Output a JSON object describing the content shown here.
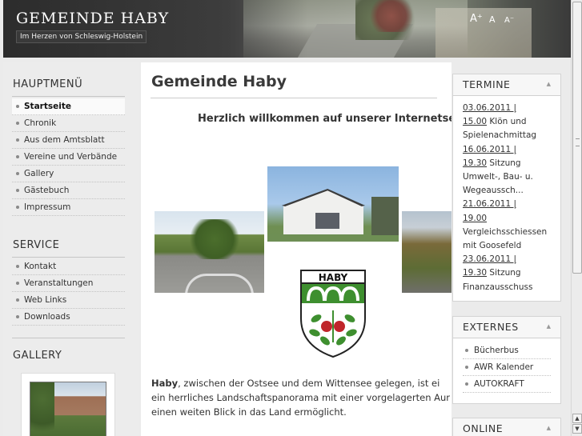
{
  "header": {
    "site_title": "GEMEINDE HABY",
    "slogan": "Im Herzen von Schleswig-Holstein",
    "font_increase": "A⁺",
    "font_reset": "A",
    "font_decrease": "A⁻"
  },
  "sidebar": {
    "main_menu_title": "HAUPTMENÜ",
    "main_menu": [
      "Startseite",
      "Chronik",
      "Aus dem Amtsblatt",
      "Vereine und Verbände",
      "Gallery",
      "Gästebuch",
      "Impressum"
    ],
    "active_item": "Startseite",
    "service_title": "SERVICE",
    "service_menu": [
      "Kontakt",
      "Veranstaltungen",
      "Web Links",
      "Downloads"
    ],
    "gallery_title": "GALLERY"
  },
  "main": {
    "page_title": "Gemeinde Haby",
    "welcome": "Herzlich willkommen auf unserer Internetsei",
    "coat_label": "HABY",
    "body_town": "Haby",
    "body_line1": ", zwischen der Ostsee und dem Wittensee gelegen, ist ei",
    "body_line2": "ein herrliches Landschaftspanorama mit einer vorgelagerten Aur",
    "body_line3": "einen weiten Blick in das Land ermöglicht."
  },
  "termine": {
    "title": "TERMINE",
    "items": [
      {
        "date": "03.06.2011 |",
        "time": "15.00",
        "desc": " Klön und Spielenachmittag"
      },
      {
        "date": "16.06.2011 |",
        "time": "19.30",
        "desc": " Sitzung Umwelt-, Bau- u. Wegeaussch..."
      },
      {
        "date": "21.06.2011 |",
        "time": "19.00",
        "desc": " Vergleichsschiessen mit Goosefeld"
      },
      {
        "date": "23.06.2011 |",
        "time": "19.30",
        "desc": " Sitzung Finanzausschuss"
      }
    ]
  },
  "externes": {
    "title": "EXTERNES",
    "items": [
      "Bücherbus",
      "AWR Kalender",
      "AUTOKRAFT"
    ]
  },
  "online": {
    "title": "ONLINE"
  },
  "colors": {
    "header_dark": "#3e3e3e",
    "sidebar_bg": "#ececec",
    "text": "#333333",
    "coat_red": "#c0262b",
    "coat_green": "#3e8f2f"
  }
}
